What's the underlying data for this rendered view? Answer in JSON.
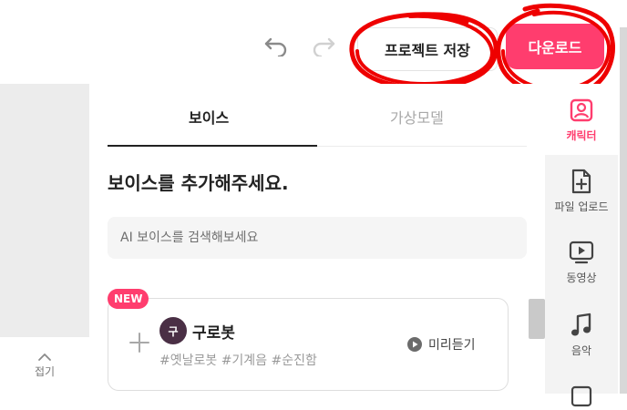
{
  "header": {
    "undo_icon": "undo-icon",
    "redo_icon": "redo-icon",
    "save_label": "프로젝트 저장",
    "download_label": "다운로드",
    "accent_color": "#ff3d6e"
  },
  "panel": {
    "tabs": [
      {
        "label": "보이스",
        "active": true
      },
      {
        "label": "가상모델",
        "active": false
      }
    ],
    "title": "보이스를 추가해주세요.",
    "search_placeholder": "AI 보이스를 검색해보세요",
    "voice_card": {
      "badge": "NEW",
      "avatar_text": "구",
      "name": "구로봇",
      "tags": "#옛날로봇 #기계음 #순진함",
      "preview_label": "미리듣기"
    }
  },
  "left": {
    "collapse_label": "접기"
  },
  "rail": {
    "items": [
      {
        "label": "캐릭터",
        "icon": "character-icon",
        "active": true
      },
      {
        "label": "파일 업로드",
        "icon": "file-upload-icon",
        "active": false
      },
      {
        "label": "동영상",
        "icon": "video-icon",
        "active": false
      },
      {
        "label": "음악",
        "icon": "music-icon",
        "active": false
      }
    ]
  }
}
